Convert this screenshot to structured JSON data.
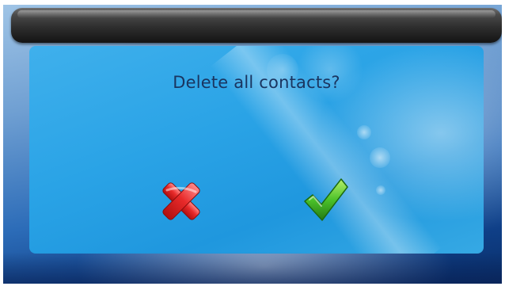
{
  "dialog": {
    "question": "Delete all contacts?",
    "cancel_icon": "red-x-icon",
    "confirm_icon": "green-check-icon"
  },
  "colors": {
    "title_bar": "#2e2e2e",
    "dialog_bg": "#2aa3e6",
    "question_text": "#1a3560",
    "cancel": "#e0202a",
    "confirm": "#3fae2a"
  }
}
